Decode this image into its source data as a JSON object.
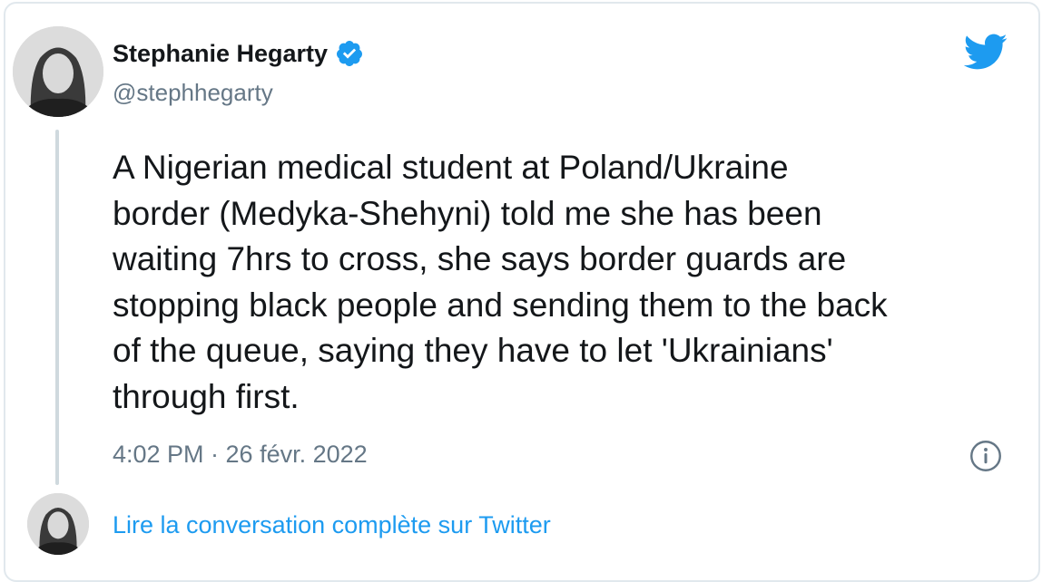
{
  "tweet": {
    "author_name": "Stephanie Hegarty",
    "author_handle": "@stephhegarty",
    "text": "A Nigerian medical student at Poland/Ukraine\nborder (Medyka-Shehyni) told me she has been\nwaiting 7hrs to cross, she says border guards are\nstopping black people and sending them to the back\nof the queue, saying they have to let 'Ukrainians'\nthrough first.",
    "timestamp": "4:02 PM · 26 févr. 2022",
    "read_conversation_label": "Lire la conversation complète sur Twitter",
    "verified": true
  },
  "icons": {
    "verified": "verified-badge-icon",
    "brand": "twitter-bird-icon",
    "info": "info-icon"
  },
  "colors": {
    "twitter_blue": "#1d9bf0",
    "text_primary": "#14171a",
    "text_secondary": "#657786",
    "border": "#e1e8ed"
  }
}
